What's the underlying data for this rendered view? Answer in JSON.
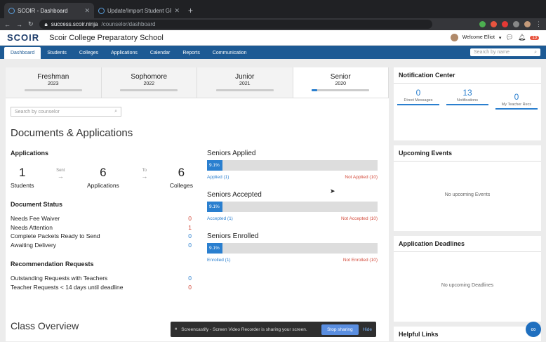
{
  "browser": {
    "tabs": [
      {
        "title": "SCOIR - Dashboard",
        "active": true
      },
      {
        "title": "Update/Import Student GPA - –",
        "active": false
      }
    ],
    "url_host": "success.scoir.ninja",
    "url_path": "/counselor/dashboard"
  },
  "header": {
    "logo": "SCOIR",
    "school": "Scoir College Preparatory School",
    "welcome": "Welcome Elliot",
    "notif_count": "13"
  },
  "nav": {
    "items": [
      "Dashboard",
      "Students",
      "Colleges",
      "Applications",
      "Calendar",
      "Reports",
      "Communication"
    ],
    "search_placeholder": "Search by name"
  },
  "classes": [
    {
      "name": "Freshman",
      "year": "2023",
      "progress": 0
    },
    {
      "name": "Sophomore",
      "year": "2022",
      "progress": 0
    },
    {
      "name": "Junior",
      "year": "2021",
      "progress": 0
    },
    {
      "name": "Senior",
      "year": "2020",
      "progress": 0.091
    }
  ],
  "counselor_search": "Search by counselor",
  "docs_title": "Documents & Applications",
  "applications": {
    "title": "Applications",
    "students": "1",
    "students_label": "Students",
    "sent": "Sent",
    "apps": "6",
    "apps_label": "Applications",
    "to": "To",
    "colleges": "6",
    "colleges_label": "Colleges"
  },
  "document_status": {
    "title": "Document Status",
    "rows": [
      {
        "label": "Needs Fee Waiver",
        "value": "0",
        "color": "#d34a3a"
      },
      {
        "label": "Needs Attention",
        "value": "1",
        "color": "#d34a3a"
      },
      {
        "label": "Complete Packets Ready to Send",
        "value": "0",
        "color": "#2a7fcf"
      },
      {
        "label": "Awaiting Delivery",
        "value": "0",
        "color": "#2a7fcf"
      }
    ]
  },
  "recommendation": {
    "title": "Recommendation Requests",
    "rows": [
      {
        "label": "Outstanding Requests with Teachers",
        "value": "0",
        "color": "#2a7fcf"
      },
      {
        "label": "Teacher Requests < 14 days until deadline",
        "value": "0",
        "color": "#d34a3a"
      }
    ]
  },
  "seniors": [
    {
      "title": "Seniors Applied",
      "pct_label": "9.1%",
      "pct": 0.091,
      "left": "Applied (1)",
      "right": "Not Applied (10)"
    },
    {
      "title": "Seniors Accepted",
      "pct_label": "9.1%",
      "pct": 0.091,
      "left": "Accepted (1)",
      "right": "Not Accepted (10)"
    },
    {
      "title": "Seniors Enrolled",
      "pct_label": "9.1%",
      "pct": 0.091,
      "left": "Enrolled (1)",
      "right": "Not Enrolled (10)"
    }
  ],
  "class_overview": "Class Overview",
  "notification_center": {
    "title": "Notification Center",
    "items": [
      {
        "num": "0",
        "label": "Direct Messages"
      },
      {
        "num": "13",
        "label": "Notifications"
      },
      {
        "num": "0",
        "label": "My Teacher Recs"
      }
    ]
  },
  "upcoming_events": {
    "title": "Upcoming Events",
    "empty": "No upcoming Events"
  },
  "app_deadlines": {
    "title": "Application Deadlines",
    "empty": "No upcoming Deadlines"
  },
  "helpful_links": {
    "title": "Helpful Links"
  },
  "toast": {
    "message": "Screencastify - Screen Video Recorder is sharing your screen.",
    "stop": "Stop sharing",
    "hide": "Hide"
  }
}
